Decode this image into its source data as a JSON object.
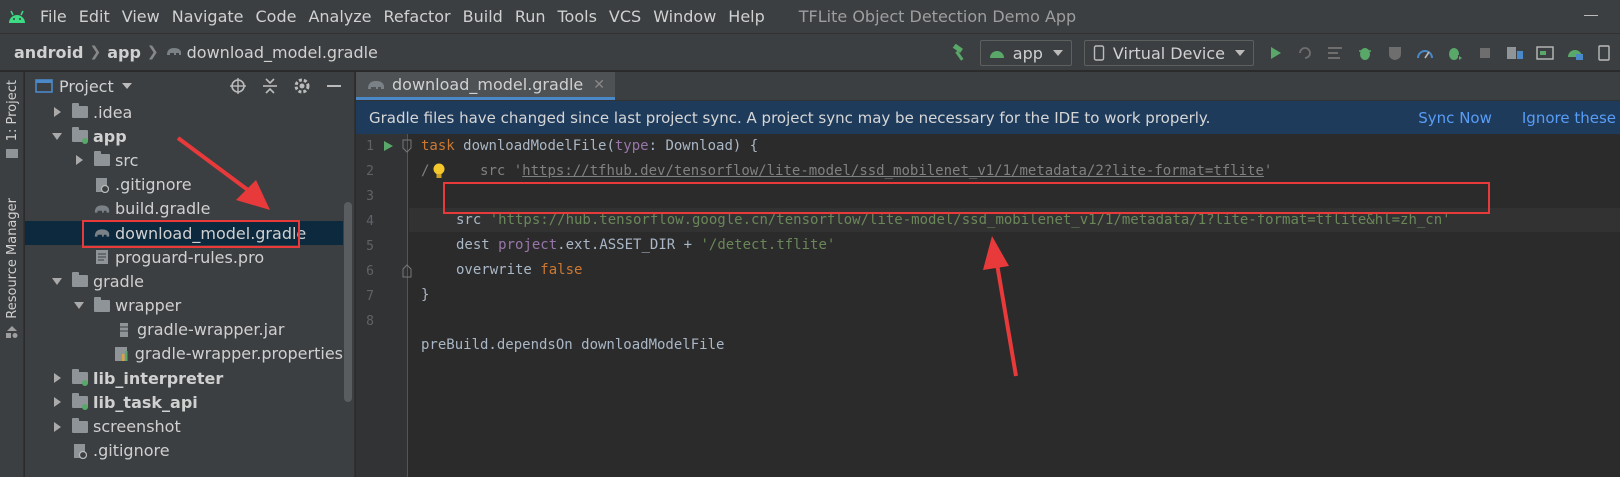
{
  "menubar": {
    "items": [
      "File",
      "Edit",
      "View",
      "Navigate",
      "Code",
      "Analyze",
      "Refactor",
      "Build",
      "Run",
      "Tools",
      "VCS",
      "Window",
      "Help"
    ],
    "window_title": "TFLite Object Detection Demo App"
  },
  "navbar": {
    "breadcrumbs": [
      "android",
      "app",
      "download_model.gradle"
    ],
    "run_config": "app",
    "device": "Virtual Device"
  },
  "left_strip": {
    "project_tab": "1: Project",
    "resource_tab": "Resource Manager"
  },
  "project_panel": {
    "title": "Project",
    "tree": [
      {
        "label": ".idea",
        "depth": 1,
        "expand": "collapsed",
        "icon": "folder-icon",
        "bold": false
      },
      {
        "label": "app",
        "depth": 1,
        "expand": "expanded",
        "icon": "module-folder-icon",
        "bold": true
      },
      {
        "label": "src",
        "depth": 2,
        "expand": "collapsed",
        "icon": "folder-icon",
        "bold": false
      },
      {
        "label": ".gitignore",
        "depth": 2,
        "expand": "none",
        "icon": "gitignore-file-icon",
        "bold": false
      },
      {
        "label": "build.gradle",
        "depth": 2,
        "expand": "none",
        "icon": "gradle-elephant-icon",
        "bold": false
      },
      {
        "label": "download_model.gradle",
        "depth": 2,
        "expand": "none",
        "icon": "gradle-elephant-icon",
        "bold": false,
        "selected": true
      },
      {
        "label": "proguard-rules.pro",
        "depth": 2,
        "expand": "none",
        "icon": "text-file-icon",
        "bold": false
      },
      {
        "label": "gradle",
        "depth": 1,
        "expand": "expanded",
        "icon": "folder-icon",
        "bold": false
      },
      {
        "label": "wrapper",
        "depth": 2,
        "expand": "expanded",
        "icon": "folder-icon",
        "bold": false
      },
      {
        "label": "gradle-wrapper.jar",
        "depth": 3,
        "expand": "none",
        "icon": "jar-file-icon",
        "bold": false
      },
      {
        "label": "gradle-wrapper.properties",
        "depth": 3,
        "expand": "none",
        "icon": "properties-file-icon",
        "bold": false
      },
      {
        "label": "lib_interpreter",
        "depth": 1,
        "expand": "collapsed",
        "icon": "module-folder-icon",
        "bold": true
      },
      {
        "label": "lib_task_api",
        "depth": 1,
        "expand": "collapsed",
        "icon": "module-folder-icon",
        "bold": true
      },
      {
        "label": "screenshot",
        "depth": 1,
        "expand": "collapsed",
        "icon": "folder-icon",
        "bold": false
      },
      {
        "label": ".gitignore",
        "depth": 1,
        "expand": "none",
        "icon": "gitignore-file-icon",
        "bold": false
      }
    ]
  },
  "editor": {
    "tab_label": "download_model.gradle",
    "banner_text": "Gradle files have changed since last project sync. A project sync may be necessary for the IDE to work properly.",
    "banner_sync_now": "Sync Now",
    "banner_ignore": "Ignore these",
    "line_numbers": [
      "1",
      "2",
      "3",
      "4",
      "5",
      "6",
      "7",
      "8"
    ],
    "code": {
      "l1_task": "task ",
      "l1_name": "downloadModelFile(",
      "l1_type": "type",
      "l1_rest": ": Download) {",
      "l2_comment": "/",
      "l2_src": "src ",
      "l2_url": "https://tfhub.dev/tensorflow/lite-model/ssd_mobilenet_v1/1/metadata/2?lite-format=tflite",
      "l3_src": "src ",
      "l3_url": "'https://hub.tensorflow.google.cn/tensorflow/lite-model/ssd_mobilenet_v1/1/metadata/1?lite-format=tflite&hl=zh_cn'",
      "l4_dest": "dest ",
      "l4_project": "project",
      "l4_mid": ".ext.ASSET_DIR + ",
      "l4_str": "'/detect.tflite'",
      "l5_overwrite": "overwrite ",
      "l5_false": "false",
      "l6": "}",
      "l8": "preBuild.dependsOn downloadModelFile"
    }
  },
  "colors": {
    "annotation_red": "#e8393b",
    "banner_bg": "#1f3b5c",
    "link_blue": "#589df6",
    "run_green": "#59a869"
  }
}
